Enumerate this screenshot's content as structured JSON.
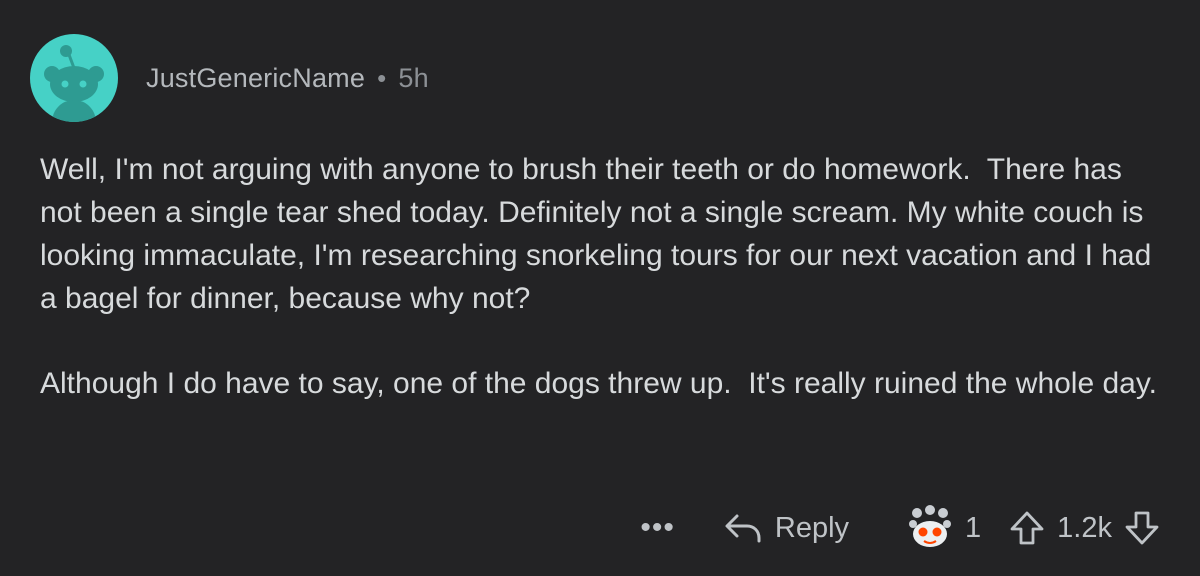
{
  "comment": {
    "username": "JustGenericName",
    "separator": "•",
    "time": "5h",
    "avatar_color": "#46d1c6",
    "paragraphs": [
      "Well, I'm not arguing with anyone to brush their teeth or do homework.  There has not been a single tear shed today. Definitely not a single scream. My white couch is looking immaculate, I'm researching snorkeling tours for our next vacation and I had a bagel for dinner, because why not?",
      "Although I do have to say, one of the dogs threw up.  It's really ruined the whole day."
    ]
  },
  "actions": {
    "more_label": "•••",
    "reply_label": "Reply",
    "award_count": "1",
    "score": "1.2k",
    "icons": [
      "more-icon",
      "reply-arrow-icon",
      "award-icon",
      "upvote-icon",
      "downvote-icon"
    ]
  }
}
